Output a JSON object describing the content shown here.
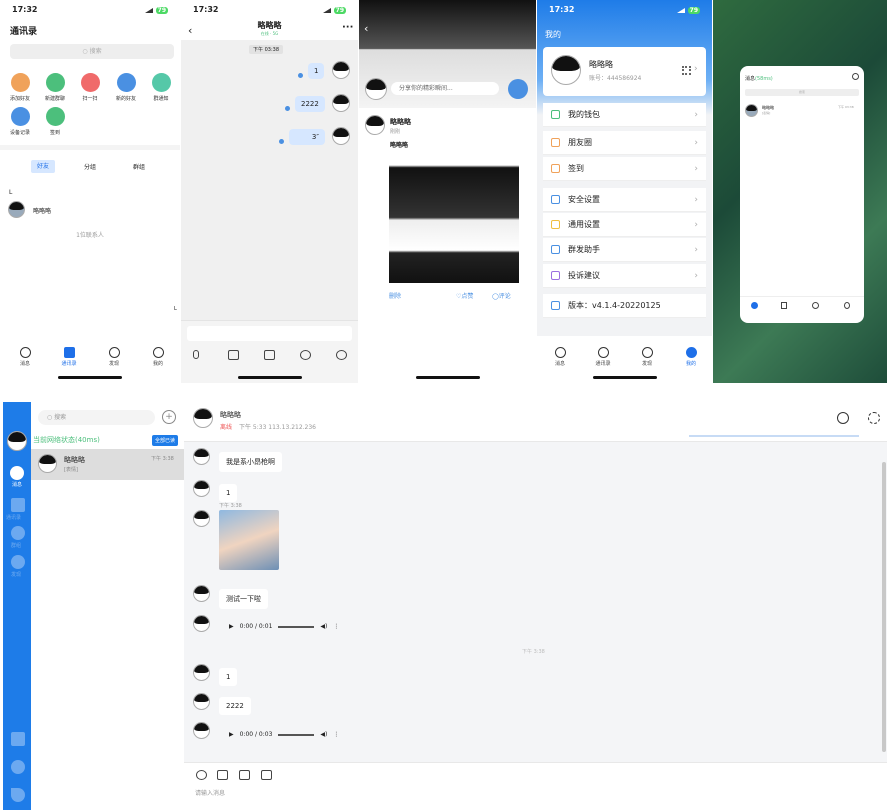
{
  "time": "17:32",
  "battery": "79",
  "p1": {
    "title": "通讯录",
    "search": "搜索",
    "actions": [
      {
        "label": "添加好友",
        "color": "#f0a25a"
      },
      {
        "label": "新建群聊",
        "color": "#4cbf7c"
      },
      {
        "label": "扫一扫",
        "color": "#f06a6a"
      },
      {
        "label": "新的好友",
        "color": "#4a90e2"
      },
      {
        "label": "群通知",
        "color": "#55c8a8"
      },
      {
        "label": "设备记录",
        "color": "#4a90e2"
      },
      {
        "label": "签到",
        "color": "#4cbf7c"
      }
    ],
    "segs": [
      "好友",
      "分组",
      "群组"
    ],
    "index": "L",
    "contact": "略略略",
    "count": "1位联系人",
    "side": "L"
  },
  "tabs": [
    "消息",
    "通讯录",
    "发现",
    "我的"
  ],
  "p2": {
    "title": "略略略",
    "status": "在线 · 5G",
    "time": "下午 03:38",
    "msgs": [
      "1",
      "2222",
      "3″"
    ]
  },
  "p3": {
    "input": "分享你的精彩瞬间...",
    "name": "略略略",
    "sub": "刚刚",
    "text": "略略略",
    "del": "删除",
    "like": "点赞",
    "comment": "评论"
  },
  "p4": {
    "header": "我的",
    "name": "略略略",
    "account": "账号：444586924",
    "items": [
      {
        "label": "我的钱包",
        "color": "#4cbf7c"
      },
      {
        "label": "朋友圈",
        "color": "#f0a25a"
      },
      {
        "label": "签到",
        "color": "#f0a25a"
      },
      {
        "label": "安全设置",
        "color": "#4a90e2"
      },
      {
        "label": "通用设置",
        "color": "#f0c040"
      },
      {
        "label": "群发助手",
        "color": "#4a90e2"
      },
      {
        "label": "投诉建议",
        "color": "#9b6fe0"
      },
      {
        "label": "版本：v4.1.4-20220125",
        "color": "#4a90e2"
      }
    ]
  },
  "p5": {
    "title": "消息",
    "ms": "(58ms)",
    "search": "搜索",
    "name": "略略略",
    "sub": "[表情]",
    "time": "下午 03:38"
  },
  "desk": {
    "search": "搜索",
    "net": "当前网络状态(40ms)",
    "readall": "全部已读",
    "contact": "略略略",
    "contact_sub": "[表情]",
    "contact_time": "下午 3:38",
    "navs": [
      "消息",
      "通讯录",
      "群组",
      "发现"
    ],
    "chat_name": "略略略",
    "chat_status": "离线",
    "chat_meta": "下午 5:33   113.13.212.236",
    "msgs": [
      "我是系小昂枪啊",
      "1",
      "",
      "测试一下啦",
      "",
      "1",
      "2222",
      ""
    ],
    "img_time": "下午 3:38",
    "divider_time": "下午 3:38",
    "audio1": "0:00 / 0:01",
    "audio2": "0:00 / 0:03",
    "input_placeholder": "请输入消息"
  }
}
